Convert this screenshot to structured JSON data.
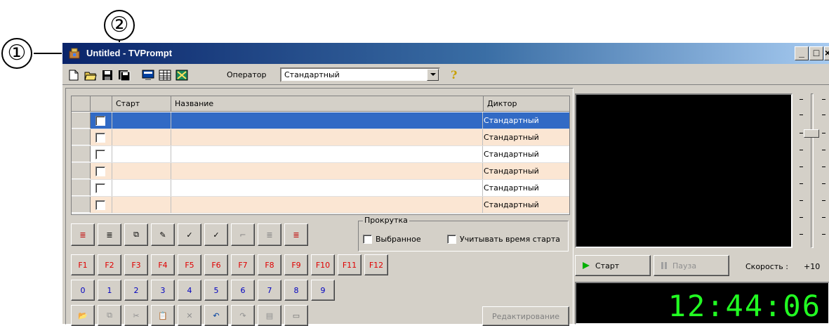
{
  "callouts": {
    "one": "①",
    "two": "②"
  },
  "window": {
    "title": "Untitled - TVPrompt",
    "controls": [
      "_",
      "□",
      "×"
    ]
  },
  "toolbar": {
    "icons": [
      "new-file-icon",
      "open-folder-icon",
      "save-icon",
      "save-all-icon",
      "monitor-icon",
      "table-icon",
      "tools-icon"
    ],
    "operator_label": "Оператор",
    "operator_value": "Стандартный",
    "help_icon": "?"
  },
  "grid": {
    "columns": [
      "",
      "",
      "Старт",
      "Название",
      "Диктор"
    ],
    "rows": [
      {
        "speaker": "Стандартный",
        "selected": true
      },
      {
        "speaker": "Стандартный"
      },
      {
        "speaker": "Стандартный"
      },
      {
        "speaker": "Стандартный"
      },
      {
        "speaker": "Стандартный"
      },
      {
        "speaker": "Стандартный"
      }
    ]
  },
  "edit_buttons": [
    "≣",
    "≣",
    "⧉",
    "✎",
    "✓",
    "✓",
    "⌐",
    "≣",
    "≣"
  ],
  "scroll_group": {
    "title": "Прокрутка",
    "selected_label": "Выбранное",
    "start_time_label": "Учитывать время старта"
  },
  "fkeys": [
    "F1",
    "F2",
    "F3",
    "F4",
    "F5",
    "F6",
    "F7",
    "F8",
    "F9",
    "F10",
    "F11",
    "F12"
  ],
  "numkeys": [
    "0",
    "1",
    "2",
    "3",
    "4",
    "5",
    "6",
    "7",
    "8",
    "9"
  ],
  "bottom_tools": [
    "📂",
    "⧉",
    "✂",
    "📋",
    "✕",
    "↶",
    "↷",
    "▤",
    "▭"
  ],
  "edit_mode_label": "Редактирование",
  "playback": {
    "start_label": "Старт",
    "pause_label": "Пауза",
    "speed_label": "Скорость :",
    "speed_value": "+10",
    "clock": "12:44:06"
  },
  "colors": {
    "title_bar": "#0a246a",
    "selection": "#316ac5",
    "alt_row": "#fbe6d3",
    "fkey_text": "#e00000",
    "numkey_text": "#0000c0",
    "clock": "#22ff22"
  }
}
